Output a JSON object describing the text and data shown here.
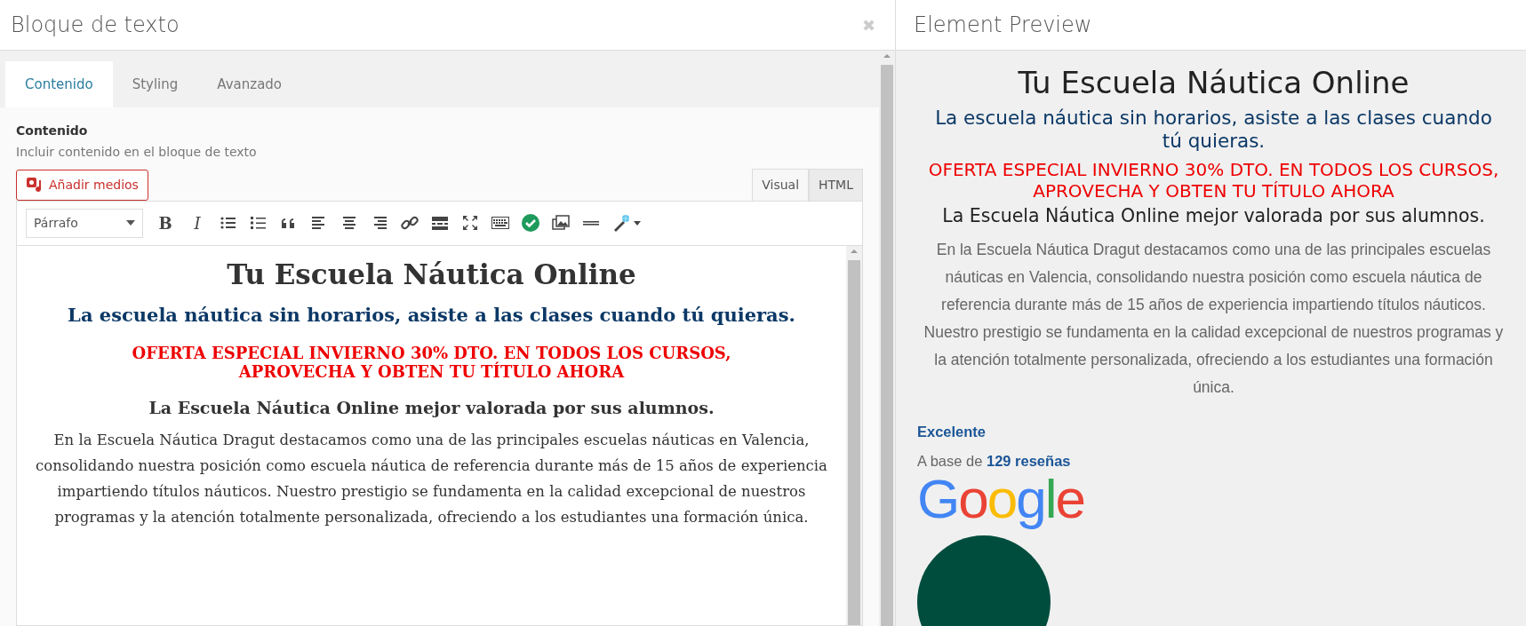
{
  "editor_panel": {
    "title": "Bloque de texto",
    "close_glyph": "✖",
    "tabs": [
      {
        "label": "Contenido",
        "selected": true
      },
      {
        "label": "Styling",
        "selected": false
      },
      {
        "label": "Avanzado",
        "selected": false
      }
    ],
    "field": {
      "label": "Contenido",
      "hint": "Incluir contenido en el bloque de texto"
    },
    "add_media_button": "Añadir medios",
    "mode_tabs": [
      {
        "label": "Visual",
        "selected": true
      },
      {
        "label": "HTML",
        "selected": false
      }
    ],
    "toolbar": {
      "format_select": "Párrafo",
      "bold_glyph": "B",
      "italic_glyph": "I"
    },
    "content": [
      {
        "kind": "title",
        "text": "Tu Escuela Náutica Online"
      },
      {
        "kind": "subtitle",
        "text": "La escuela náutica sin horarios, asiste a las clases cuando tú quieras."
      },
      {
        "kind": "offer",
        "text": "OFERTA ESPECIAL INVIERNO 30% DTO. EN TODOS LOS CURSOS, APROVECHA Y OBTEN TU TÍTULO AHORA"
      },
      {
        "kind": "subheading",
        "text": "La Escuela Náutica Online mejor valorada por sus alumnos."
      },
      {
        "kind": "paragraph",
        "text": "En la Escuela Náutica Dragut destacamos como una de las principales escuelas náuticas en Valencia, consolidando nuestra posición como escuela náutica de referencia durante más de 15 años de experiencia impartiendo títulos náuticos. Nuestro  prestigio se fundamenta en la calidad excepcional de nuestros programas y la atención totalmente personalizada, ofreciendo a los estudiantes una formación única."
      }
    ]
  },
  "preview_panel": {
    "title": "Element Preview",
    "content": [
      {
        "kind": "title",
        "text": "Tu Escuela Náutica Online"
      },
      {
        "kind": "subtitle",
        "text": "La escuela náutica sin horarios, asiste a las clases cuando tú quieras."
      },
      {
        "kind": "offer",
        "text": "OFERTA ESPECIAL INVIERNO 30% DTO. EN TODOS LOS CURSOS, APROVECHA Y OBTEN TU TÍTULO AHORA"
      },
      {
        "kind": "subheading",
        "text": "La Escuela Náutica Online mejor valorada por sus alumnos."
      },
      {
        "kind": "paragraph",
        "text": "En la Escuela Náutica Dragut destacamos como una de las principales escuelas náuticas en Valencia, consolidando nuestra posición como escuela náutica de referencia durante más de 15 años de experiencia impartiendo títulos náuticos. Nuestro  prestigio se fundamenta en la calidad excepcional de nuestros programas y la atención totalmente personalizada, ofreciendo a los estudiantes una formación única."
      }
    ],
    "rating": {
      "label": "Excelente",
      "summary": "A base de **129 reseñas**",
      "logo": "Google"
    }
  }
}
